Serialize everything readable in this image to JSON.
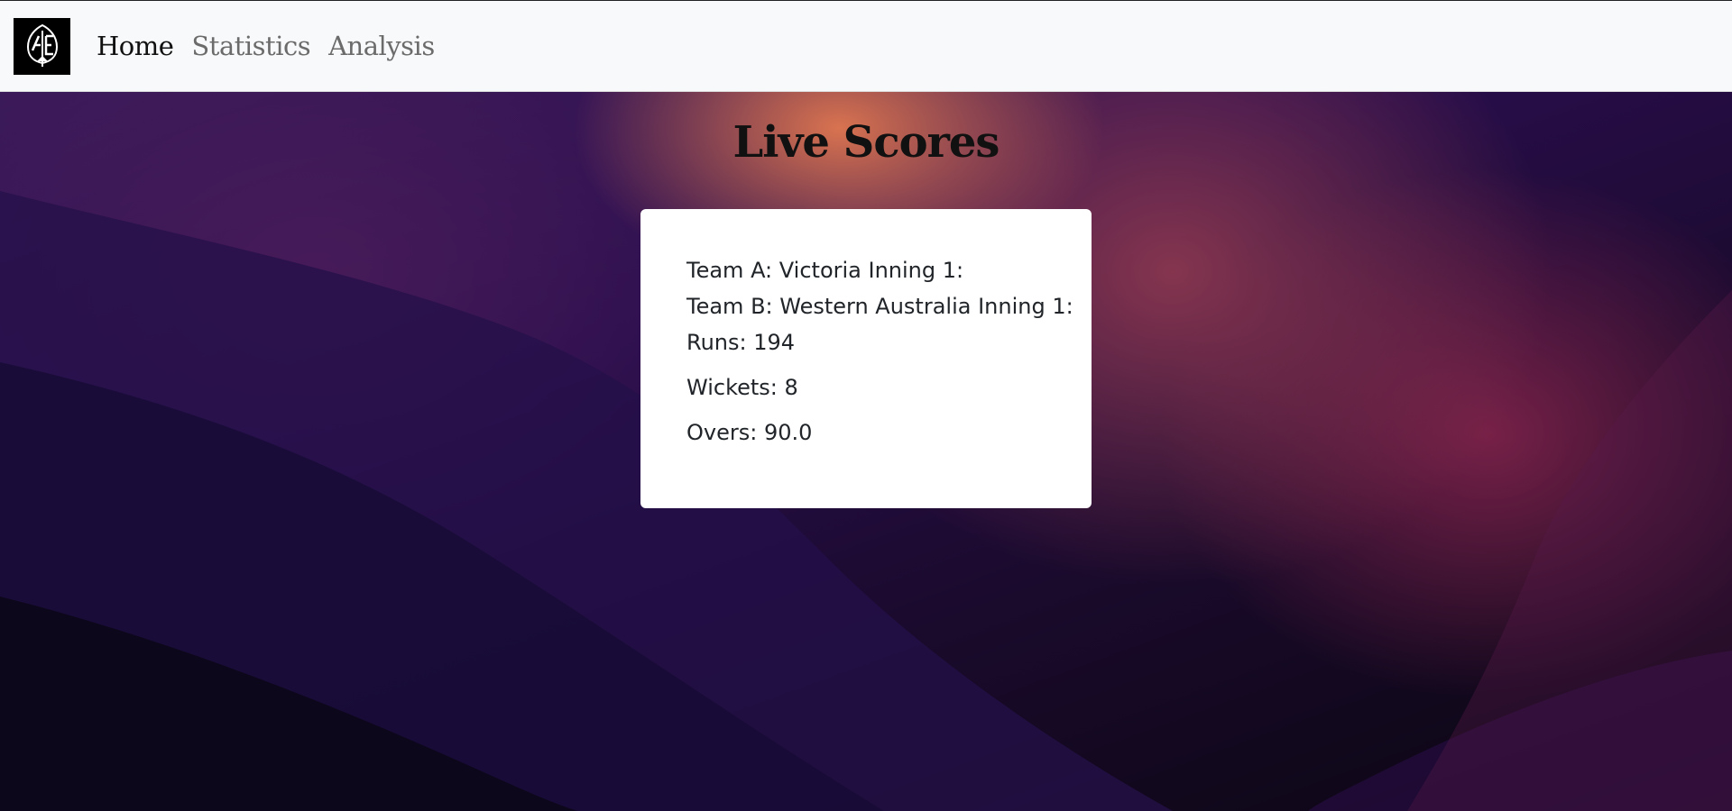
{
  "nav": {
    "logo_alt": "cricket-logo",
    "links": [
      "Home",
      "Statistics",
      "Analysis"
    ]
  },
  "page": {
    "title": "Live Scores"
  },
  "score": {
    "team_a": "Team A: Victoria Inning 1:",
    "team_b": "Team B: Western Australia Inning 1:",
    "runs": "Runs: 194",
    "wickets": "Wickets: 8",
    "overs": "Overs: 90.0"
  },
  "colors": {
    "navbar_bg": "#f8f9fa",
    "active_link": "#111111",
    "inactive_link": "#6b6b6b",
    "card_bg": "#ffffff"
  }
}
